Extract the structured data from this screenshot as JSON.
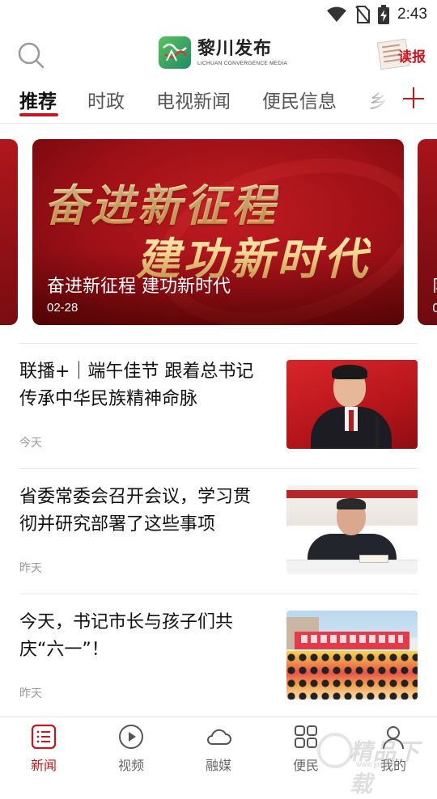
{
  "status_bar": {
    "time": "2:43",
    "icons": [
      "wifi-icon",
      "no-sim-icon",
      "battery-charging-icon"
    ]
  },
  "header": {
    "logo_title": "黎川发布",
    "logo_subtitle": "LICHUAN CONVERGENCE MEDIA",
    "read_paper_label": "读报",
    "icons": [
      "search-icon",
      "newspaper-icon"
    ]
  },
  "tabs": {
    "items": [
      {
        "label": "推荐",
        "active": true
      },
      {
        "label": "时政",
        "active": false
      },
      {
        "label": "电视新闻",
        "active": false
      },
      {
        "label": "便民信息",
        "active": false
      },
      {
        "label": "乡",
        "active": false
      }
    ],
    "add_icon": "plus-icon",
    "accent_color": "#c8161e"
  },
  "carousel": {
    "current": {
      "art_line1": "奋进新征程",
      "art_line2": "建功新时代",
      "caption": "奋进新征程 建功新时代",
      "date": "02-28"
    },
    "next_peek": {
      "caption": "阝",
      "date": "0"
    }
  },
  "news": [
    {
      "title": "联播+｜端午佳节 跟着总书记传承中华民族精神命脉",
      "time": "今天"
    },
    {
      "title": "省委常委会召开会议，学习贯彻并研究部署了这些事项",
      "time": "昨天"
    },
    {
      "title": "今天，书记市长与孩子们共庆“六一”！",
      "time": "昨天"
    }
  ],
  "bottom_nav": {
    "items": [
      {
        "label": "新闻",
        "icon": "news-list-icon",
        "active": true
      },
      {
        "label": "视频",
        "icon": "play-circle-icon",
        "active": false
      },
      {
        "label": "融媒",
        "icon": "cloud-icon",
        "active": false
      },
      {
        "label": "便民",
        "icon": "grid-icon",
        "active": false
      },
      {
        "label": "我的",
        "icon": "user-icon",
        "active": false
      }
    ]
  },
  "watermark": {
    "text": "精品下载",
    "url": "www.jpxz.net"
  }
}
